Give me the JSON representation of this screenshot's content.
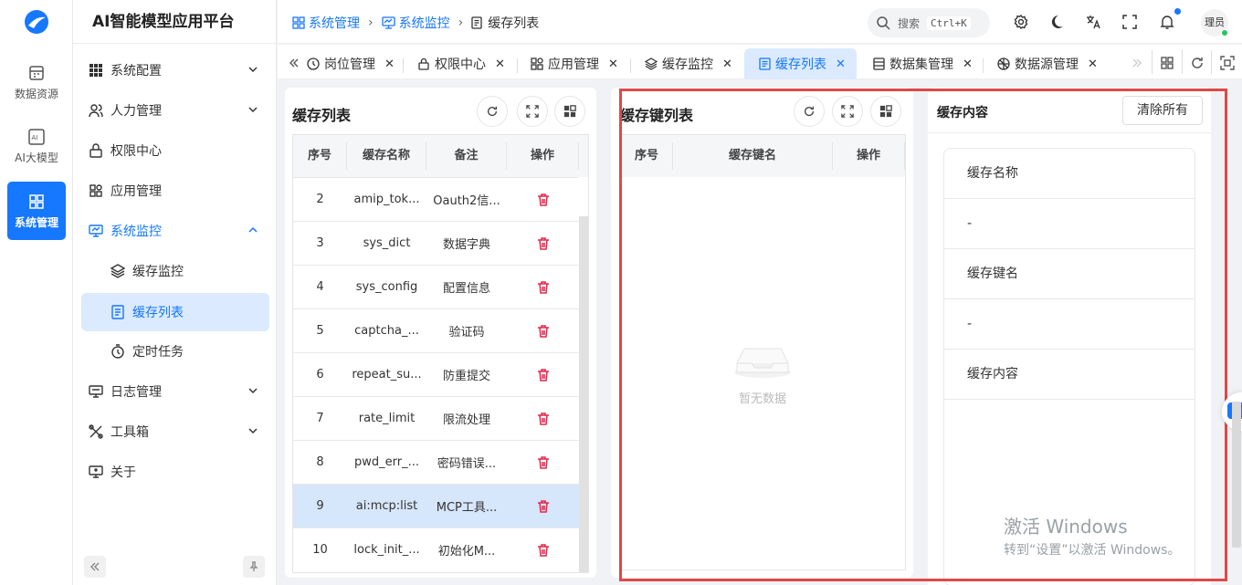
{
  "rail": {
    "items": [
      {
        "label": "数据资源",
        "icon": "database-icon"
      },
      {
        "label": "AI大模型",
        "icon": "ai-icon"
      },
      {
        "label": "系统管理",
        "icon": "system-icon",
        "active": true
      }
    ]
  },
  "sidebar": {
    "title": "AI智能模型应用平台",
    "items": [
      {
        "label": "系统配置",
        "icon": "grid-icon"
      },
      {
        "label": "人力管理",
        "icon": "users-icon"
      },
      {
        "label": "权限中心",
        "icon": "lock-icon"
      },
      {
        "label": "应用管理",
        "icon": "apps-icon"
      },
      {
        "label": "系统监控",
        "icon": "monitor-icon"
      },
      {
        "label": "缓存监控",
        "icon": "layers-icon"
      },
      {
        "label": "缓存列表",
        "icon": "list-icon"
      },
      {
        "label": "定时任务",
        "icon": "timer-icon"
      },
      {
        "label": "日志管理",
        "icon": "log-icon"
      },
      {
        "label": "工具箱",
        "icon": "tools-icon"
      },
      {
        "label": "关于",
        "icon": "about-icon"
      }
    ]
  },
  "header": {
    "breadcrumb": [
      "系统管理",
      "系统监控",
      "缓存列表"
    ],
    "search_placeholder": "搜索",
    "search_shortcut": "Ctrl+K",
    "user": "理员"
  },
  "tabs": [
    {
      "label": "岗位管理"
    },
    {
      "label": "权限中心"
    },
    {
      "label": "应用管理"
    },
    {
      "label": "缓存监控"
    },
    {
      "label": "缓存列表",
      "active": true
    },
    {
      "label": "数据集管理"
    },
    {
      "label": "数据源管理"
    }
  ],
  "cache_list": {
    "title": "缓存列表",
    "columns": [
      "序号",
      "缓存名称",
      "备注",
      "操作"
    ],
    "rows": [
      {
        "no": "2",
        "name": "amip_tok...",
        "remark": "Oauth2信..."
      },
      {
        "no": "3",
        "name": "sys_dict",
        "remark": "数据字典"
      },
      {
        "no": "4",
        "name": "sys_config",
        "remark": "配置信息"
      },
      {
        "no": "5",
        "name": "captcha_...",
        "remark": "验证码"
      },
      {
        "no": "6",
        "name": "repeat_su...",
        "remark": "防重提交"
      },
      {
        "no": "7",
        "name": "rate_limit",
        "remark": "限流处理"
      },
      {
        "no": "8",
        "name": "pwd_err_...",
        "remark": "密码错误..."
      },
      {
        "no": "9",
        "name": "ai:mcp:list",
        "remark": "MCP工具...",
        "selected": true
      },
      {
        "no": "10",
        "name": "lock_init_...",
        "remark": "初始化M..."
      }
    ]
  },
  "cache_keys": {
    "title": "缓存键列表",
    "columns": [
      "序号",
      "缓存键名",
      "操作"
    ],
    "empty": "暂无数据"
  },
  "cache_content": {
    "title": "缓存内容",
    "clear_all": "清除所有",
    "fields": [
      "缓存名称",
      "-",
      "缓存键名",
      "-",
      "缓存内容"
    ]
  },
  "watermark": {
    "line1": "激活 Windows",
    "line2": "转到“设置”以激活 Windows。"
  },
  "colors": {
    "accent": "#1677ff",
    "danger": "#e0284a",
    "highlight": "#e04848"
  }
}
